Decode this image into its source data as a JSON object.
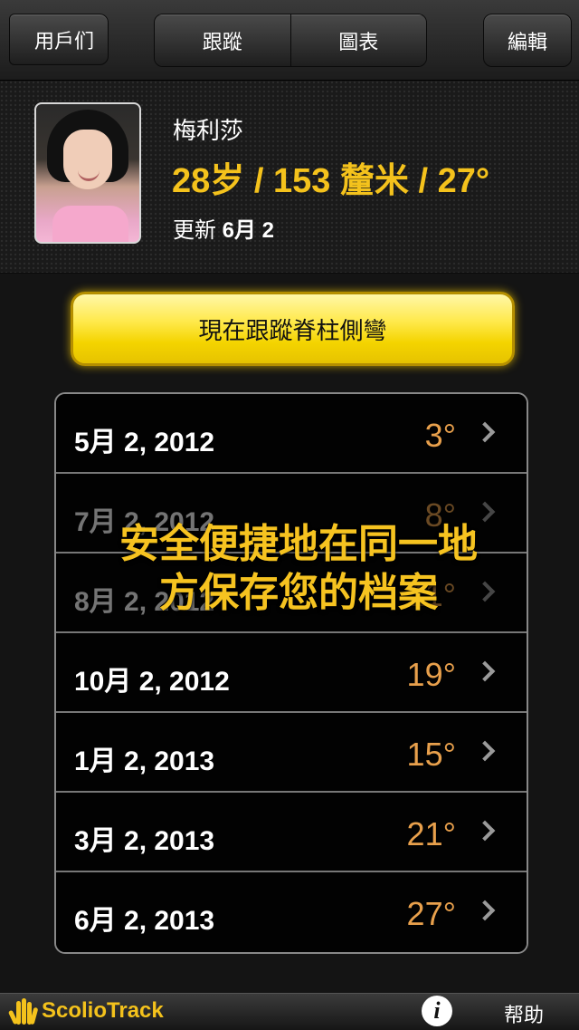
{
  "nav": {
    "back_label": "用戶们",
    "tabs": [
      {
        "label": "跟蹤"
      },
      {
        "label": "圖表"
      }
    ],
    "edit_label": "編輯"
  },
  "profile": {
    "name": "梅利莎",
    "stats": "28岁 / 153 釐米 / 27°",
    "updated_prefix": "更新",
    "updated_date": "6月 2"
  },
  "track_button_label": "現在跟蹤脊柱側彎",
  "records": [
    {
      "date": "5月 2, 2012",
      "angle": "3°"
    },
    {
      "date": "7月 2, 2012",
      "angle": "8°"
    },
    {
      "date": "8月 2, 2012",
      "angle": "11°"
    },
    {
      "date": "10月 2, 2012",
      "angle": "19°"
    },
    {
      "date": "1月 2, 2013",
      "angle": "15°"
    },
    {
      "date": "3月 2, 2013",
      "angle": "21°"
    },
    {
      "date": "6月 2, 2013",
      "angle": "27°"
    }
  ],
  "overlay": {
    "line1": "安全便捷地在同一地",
    "line2": "方保存您的档案"
  },
  "bottom": {
    "brand": "ScolioTrack",
    "info_glyph": "i",
    "help_label": "帮助"
  },
  "colors": {
    "accent": "#f4c21c",
    "angle": "#e8a04c"
  }
}
